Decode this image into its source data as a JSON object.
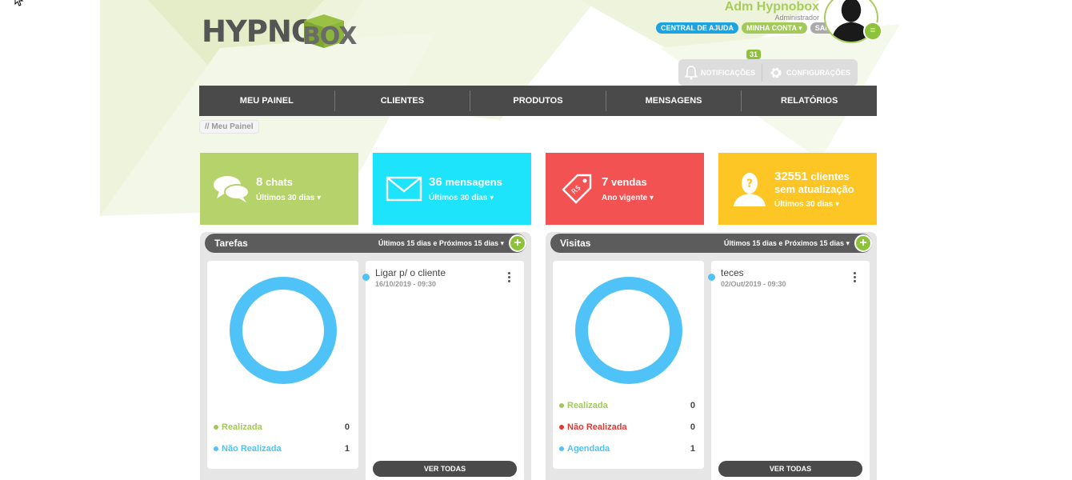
{
  "logo": {
    "text": "HYPNO",
    "box_text": "BOX"
  },
  "user": {
    "name": "Adm Hypnobox",
    "role": "Administrador",
    "links": [
      "CENTRAL DE AJUDA",
      "MINHA CONTA ▾",
      "SAIR"
    ]
  },
  "quick": {
    "notifications_label": "NOTIFICAÇÕES",
    "notifications_count": "31",
    "settings_label": "CONFIGURAÇÕES"
  },
  "nav": [
    "MEU PAINEL",
    "CLIENTES",
    "PRODUTOS",
    "MENSAGENS",
    "RELATÓRIOS"
  ],
  "breadcrumb": "// Meu Painel",
  "cards": {
    "chats": {
      "num": "8",
      "label": "chats",
      "period": "Últimos 30 dias ▾",
      "color": "#b5d36a",
      "icon": "chat-bubbles-icon"
    },
    "messages": {
      "num": "36",
      "label": "mensagens",
      "period": "Últimos 30 dias ▾",
      "color": "#1de3fb",
      "icon": "envelope-icon"
    },
    "sales": {
      "num": "7",
      "label": "vendas",
      "period": "Ano vigente ▾",
      "color": "#f35252",
      "icon": "price-tag-icon"
    },
    "clients": {
      "num": "32551",
      "label": "clientes",
      "label2": "sem atualização",
      "period": "Últimos 30 dias ▾",
      "color": "#fdc624",
      "icon": "unknown-person-icon"
    }
  },
  "tarefas": {
    "title": "Tarefas",
    "filter": "Últimos 15 dias e Próximos 15 dias ▾",
    "legend": [
      {
        "label": "Realizada",
        "value": "0",
        "color": "#a4c95b"
      },
      {
        "label": "Não Realizada",
        "value": "1",
        "color": "#4fc3f7"
      }
    ],
    "items": [
      {
        "title": "Ligar p/ o cliente",
        "date": "16/10/2019 - 09:30"
      }
    ],
    "see_all": "VER TODAS"
  },
  "visitas": {
    "title": "Visitas",
    "filter": "Últimos 15 dias e Próximos 15 dias ▾",
    "legend": [
      {
        "label": "Realizada",
        "value": "0",
        "color": "#a4c95b"
      },
      {
        "label": "Não Realizada",
        "value": "0",
        "color": "#e53935"
      },
      {
        "label": "Agendada",
        "value": "1",
        "color": "#4fc3f7"
      }
    ],
    "items": [
      {
        "title": "teces",
        "date": "02/Out/2019 - 09:30"
      }
    ],
    "see_all": "VER TODAS"
  },
  "colors": {
    "nav": "#4a4a4a",
    "accent_green": "#8fc23c",
    "donut": "#4fc3f7"
  }
}
